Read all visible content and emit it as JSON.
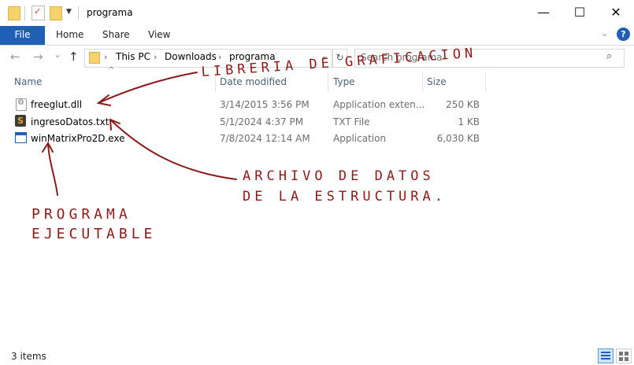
{
  "window": {
    "title": "programa",
    "minimize_icon": "minimize-icon",
    "maximize_icon": "maximize-icon",
    "close_icon": "close-icon",
    "minimize_glyph": "—",
    "maximize_glyph": "☐",
    "close_glyph": "✕"
  },
  "ribbon": {
    "tabs": [
      "File",
      "Home",
      "Share",
      "View"
    ],
    "help": "?"
  },
  "nav": {
    "back": "←",
    "forward": "→",
    "recent": "⌄",
    "up": "↑"
  },
  "address": {
    "crumbs": [
      "This PC",
      "Downloads",
      "programa"
    ],
    "separator": "›"
  },
  "search": {
    "placeholder": "Search programa"
  },
  "columns": [
    "Name",
    "Date modified",
    "Type",
    "Size"
  ],
  "files": [
    {
      "name": "freeglut.dll",
      "date": "3/14/2015 3:56 PM",
      "type": "Application exten...",
      "size": "250 KB",
      "icon": "dll-file-icon"
    },
    {
      "name": "ingresoDatos.txt",
      "date": "5/1/2024 4:37 PM",
      "type": "TXT File",
      "size": "1 KB",
      "icon": "sublime-text-file-icon"
    },
    {
      "name": "winMatrixPro2D.exe",
      "date": "7/8/2024 12:14 AM",
      "type": "Application",
      "size": "6,030 KB",
      "icon": "application-exe-icon"
    }
  ],
  "annotations": {
    "library": [
      "LIBRERIA DE GRAFICACION"
    ],
    "data_file": [
      "ARCHIVO DE DATOS",
      "DE LA ESTRUCTURA."
    ],
    "program": [
      "PROGRAMA",
      "EJECUTABLE"
    ]
  },
  "status": {
    "items_text": "3 items"
  },
  "colors": {
    "file_tab": "#1f5fb4",
    "annotation_ink": "#8b1a1a",
    "column_header": "#4c607a"
  }
}
